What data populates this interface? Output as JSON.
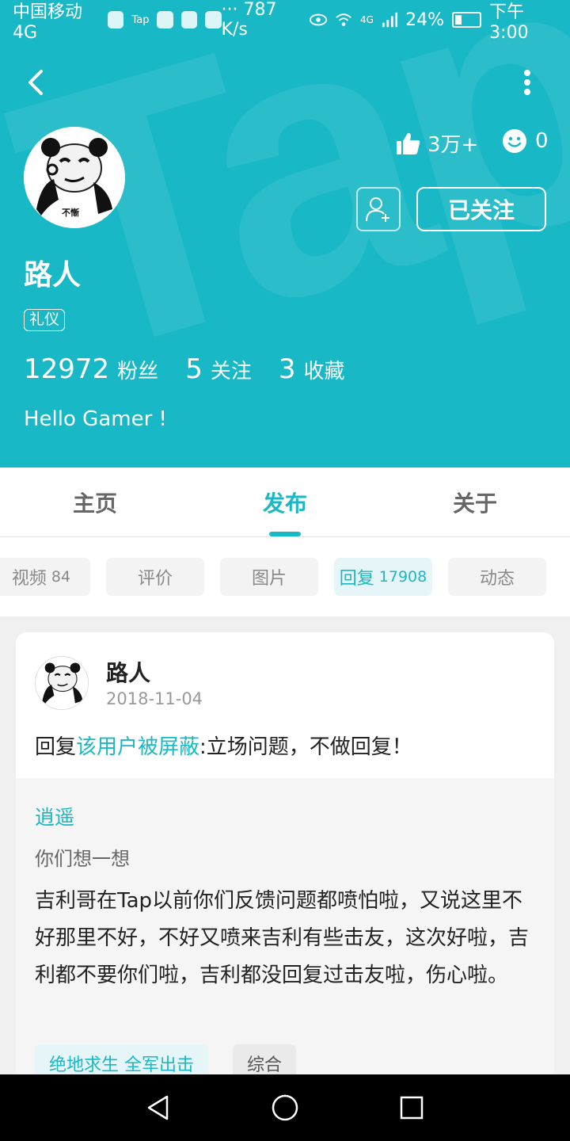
{
  "status_bar": {
    "carrier": "中国移动4G",
    "tap_label": "Tap",
    "speed": "··· 787 K/s",
    "signal": "4G",
    "battery": "24%",
    "time": "下午3:00"
  },
  "profile": {
    "avatar_caption": "不慚",
    "likes": "3万+",
    "smiles": "0",
    "follow_label": "已关注",
    "name": "路人",
    "badge": "礼仪",
    "fans_count": "12972",
    "fans_label": "粉丝",
    "following_count": "5",
    "following_label": "关注",
    "favorites_count": "3",
    "favorites_label": "收藏",
    "bio": "Hello Gamer !"
  },
  "tabs": [
    {
      "label": "主页",
      "active": false
    },
    {
      "label": "发布",
      "active": true
    },
    {
      "label": "关于",
      "active": false
    }
  ],
  "chips": [
    {
      "label": "视频",
      "count": "84",
      "active": false
    },
    {
      "label": "评价",
      "count": "",
      "active": false
    },
    {
      "label": "图片",
      "count": "",
      "active": false
    },
    {
      "label": "回复",
      "count": "17908",
      "active": true
    },
    {
      "label": "动态",
      "count": "",
      "active": false
    }
  ],
  "post": {
    "user": "路人",
    "date": "2018-11-04",
    "reply_prefix": "回复",
    "reply_target": "该用户被屏蔽",
    "reply_text": ":立场问题，不做回复！",
    "quoted_user": "逍遥",
    "quoted_title": "你们想一想",
    "quoted_body": "吉利哥在Tap以前你们反馈问题都喷怕啦，又说这里不好那里不好，不好又喷来吉利有些击友，这次好啦，吉利都不要你们啦，吉利都没回复过击友啦，伤心啦。",
    "game_tag": "绝地求生 全军出击",
    "category_tag": "综合"
  },
  "colors": {
    "accent": "#19b8c6",
    "card_bg": "#ffffff",
    "page_bg": "#f0f0f0"
  },
  "icons": {
    "back": "chevron-left-icon",
    "more": "more-vertical-icon",
    "like": "thumbs-up-icon",
    "smile": "smile-icon",
    "add_friend": "add-friend-icon",
    "nav_back": "triangle-back-icon",
    "nav_home": "circle-home-icon",
    "nav_recent": "square-recent-icon"
  }
}
